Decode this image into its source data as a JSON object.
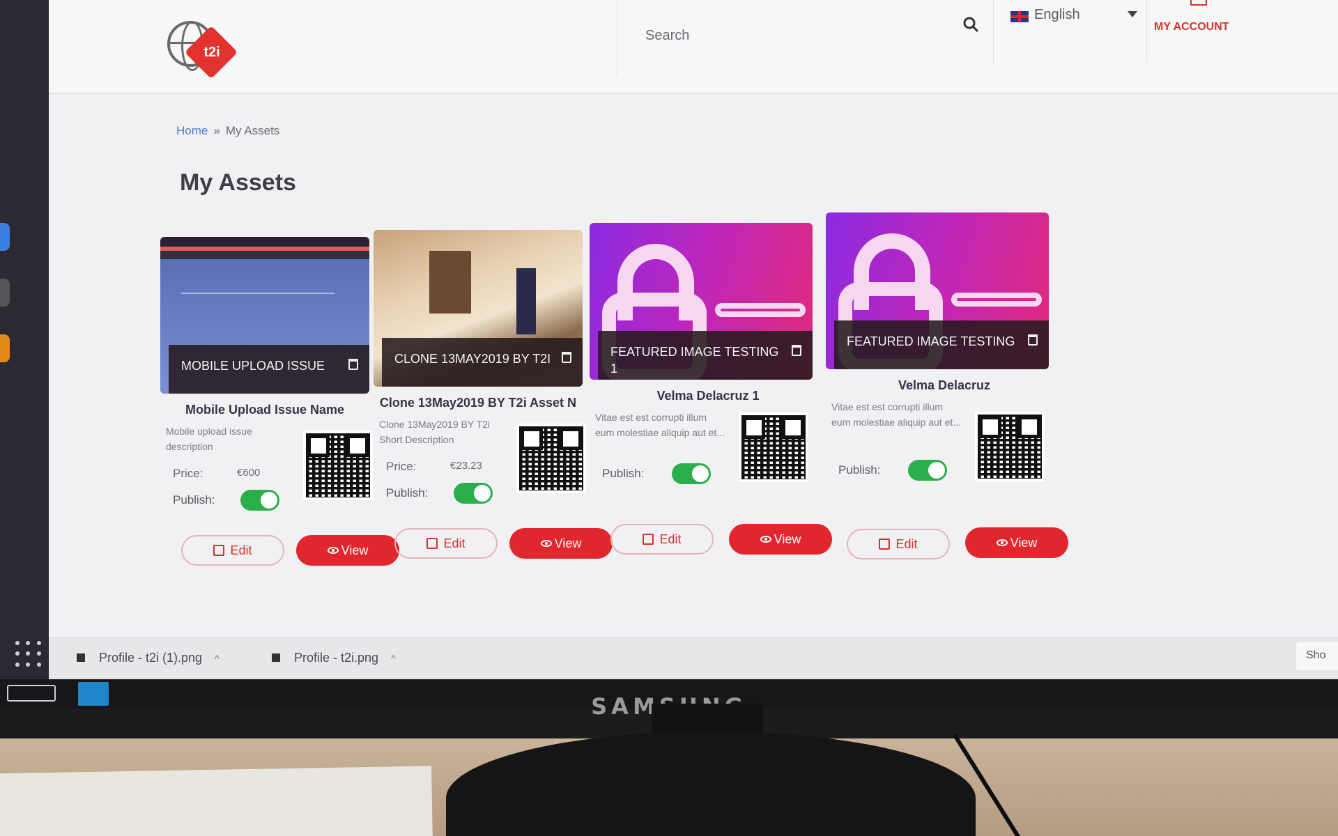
{
  "header": {
    "logo_text": "t2i",
    "search_label": "Search",
    "language": "English",
    "account_label": "MY ACCOUNT"
  },
  "breadcrumb": {
    "home": "Home",
    "separator": "»",
    "current": "My Assets"
  },
  "page_title": "My Assets",
  "cards": [
    {
      "image_caption": "MOBILE UPLOAD ISSUE",
      "name": "Mobile Upload Issue Name",
      "description": "Mobile upload issue description",
      "price_label": "Price:",
      "price": "€600",
      "publish_label": "Publish:",
      "published": true,
      "edit_label": "Edit",
      "view_label": "View"
    },
    {
      "image_caption": "CLONE 13MAY2019 BY T2I",
      "name": "Clone 13May2019 BY T2i Asset N",
      "description": "Clone 13May2019 BY T2i Short Description",
      "price_label": "Price:",
      "price": "€23.23",
      "publish_label": "Publish:",
      "published": true,
      "edit_label": "Edit",
      "view_label": "View"
    },
    {
      "image_caption": "FEATURED IMAGE TESTING 1",
      "name": "Velma Delacruz 1",
      "description": "Vitae est est corrupti illum eum molestiae aliquip aut et...",
      "publish_label": "Publish:",
      "published": true,
      "edit_label": "Edit",
      "view_label": "View"
    },
    {
      "image_caption": "FEATURED IMAGE TESTING",
      "name": "Velma Delacruz",
      "description": "Vitae est est corrupti illum eum molestiae aliquip aut et...",
      "publish_label": "Publish:",
      "published": true,
      "edit_label": "Edit",
      "view_label": "View"
    }
  ],
  "downloads": {
    "items": [
      "Profile - t2i (1).png",
      "Profile - t2i.png"
    ],
    "show_all": "Sho"
  },
  "monitor_brand": "SAMSUNG",
  "colors": {
    "accent_red": "#e1262d",
    "toggle_green": "#2aaf4a",
    "link_blue": "#4c7fc9"
  }
}
